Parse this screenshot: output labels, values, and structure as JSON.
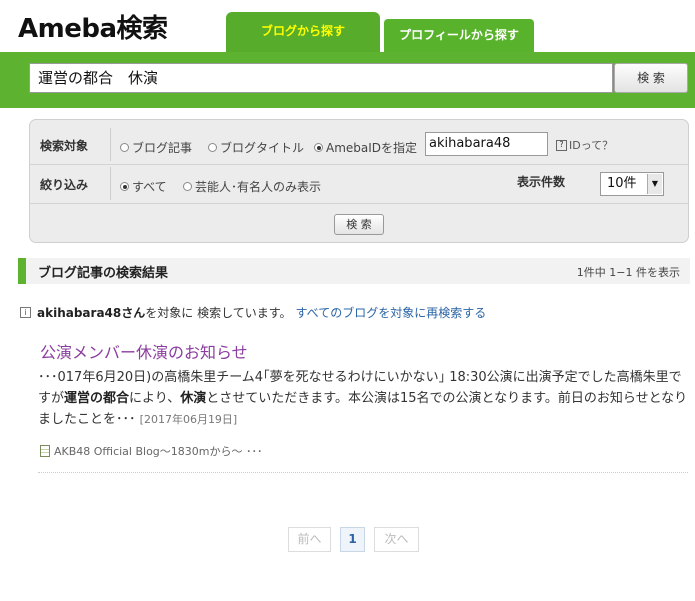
{
  "header": {
    "logo": "Ameba検索",
    "tabs": [
      {
        "label": "ブログから探す",
        "active": true
      },
      {
        "label": "プロフィールから探す",
        "active": false
      }
    ]
  },
  "search": {
    "query": "運営の都合　休演",
    "button_label": "検 索"
  },
  "options": {
    "target_label": "検索対象",
    "target_options": [
      {
        "label": "ブログ記事",
        "selected": false
      },
      {
        "label": "ブログタイトル",
        "selected": false
      },
      {
        "label": "AmebaIDを指定",
        "selected": true
      }
    ],
    "ameba_id_value": "akihabara48",
    "help_icon": "?",
    "help_text": "IDって？",
    "filter_label": "絞り込み",
    "filter_options": [
      {
        "label": "すべて",
        "selected": true
      },
      {
        "label": "芸能人･有名人のみ表示",
        "selected": false
      }
    ],
    "count_label": "表示件数",
    "count_value": "10件",
    "search_button_label": "検 索"
  },
  "results": {
    "heading": "ブログ記事の検索結果",
    "count_text": "1件中 1−1 件を表示",
    "info": {
      "icon": "i",
      "user": "akihabara48さん",
      "text": "を対象に 検索しています。",
      "link": "すべてのブログを対象に再検索する"
    },
    "items": [
      {
        "title": "公演メンバー休演のお知らせ",
        "snippet_1": "･･･017年6月20日)の高橋朱里チーム4｢夢を死なせるわけにいかない｣ 18:30公演に出演予定でした高橋朱里ですが",
        "snippet_bold_1": "運営の都合",
        "snippet_2": "により、",
        "snippet_bold_2": "休演",
        "snippet_3": "とさせていただきます。本公演は15名での公演となります。前日のお知らせとなりましたことを･･･",
        "date": "[2017年06月19日]",
        "source": "AKB48 Official Blog〜1830mから〜 ･･･"
      }
    ]
  },
  "pagination": {
    "prev": "前へ",
    "current": "1",
    "next": "次へ"
  },
  "colors": {
    "brand_green": "#5db32f",
    "title_purple": "#8b3d9f",
    "link_blue": "#2a64a6"
  }
}
